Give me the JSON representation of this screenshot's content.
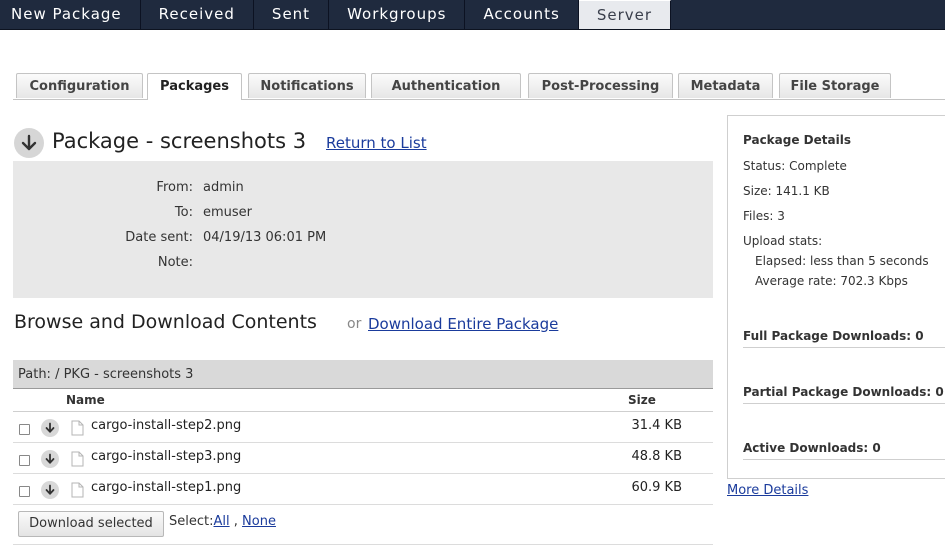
{
  "topnav": [
    "New Package",
    "Received",
    "Sent",
    "Workgroups",
    "Accounts",
    "Server"
  ],
  "tabs": [
    "Configuration",
    "Packages",
    "Notifications",
    "Authentication",
    "Post-Processing",
    "Metadata",
    "File Storage"
  ],
  "package": {
    "title": "Package - screenshots 3",
    "return_link": "Return to List",
    "from_label": "From:",
    "from": "admin",
    "to_label": "To:",
    "to": "emuser",
    "date_label": "Date sent:",
    "date": "04/19/13 06:01 PM",
    "note_label": "Note:",
    "note": ""
  },
  "browse": {
    "title": "Browse and Download Contents",
    "or": "or",
    "download_all": "Download Entire Package",
    "path": "Path: / PKG - screenshots 3",
    "col_name": "Name",
    "col_size": "Size",
    "files": [
      {
        "name": "cargo-install-step2.png",
        "size": "31.4 KB"
      },
      {
        "name": "cargo-install-step3.png",
        "size": "48.8 KB"
      },
      {
        "name": "cargo-install-step1.png",
        "size": "60.9 KB"
      }
    ],
    "download_selected": "Download selected",
    "select_label": "Select:",
    "select_all": "All",
    "select_sep": ",",
    "select_none": "None"
  },
  "details": {
    "heading": "Package Details",
    "status": "Status: Complete",
    "size": "Size: 141.1 KB",
    "files": "Files: 3",
    "upload_stats": "Upload stats:",
    "elapsed": "Elapsed: less than 5 seconds",
    "avg_rate": "Average rate: 702.3 Kbps",
    "full_downloads": "Full Package Downloads: 0",
    "partial_downloads": "Partial Package Downloads: 0",
    "active_downloads": "Active Downloads: 0",
    "more_details": "More Details"
  },
  "colors": {
    "nav_bg": "#1f2a3e",
    "link": "#1a3b9c",
    "meta_bg": "#e8e8e8"
  }
}
